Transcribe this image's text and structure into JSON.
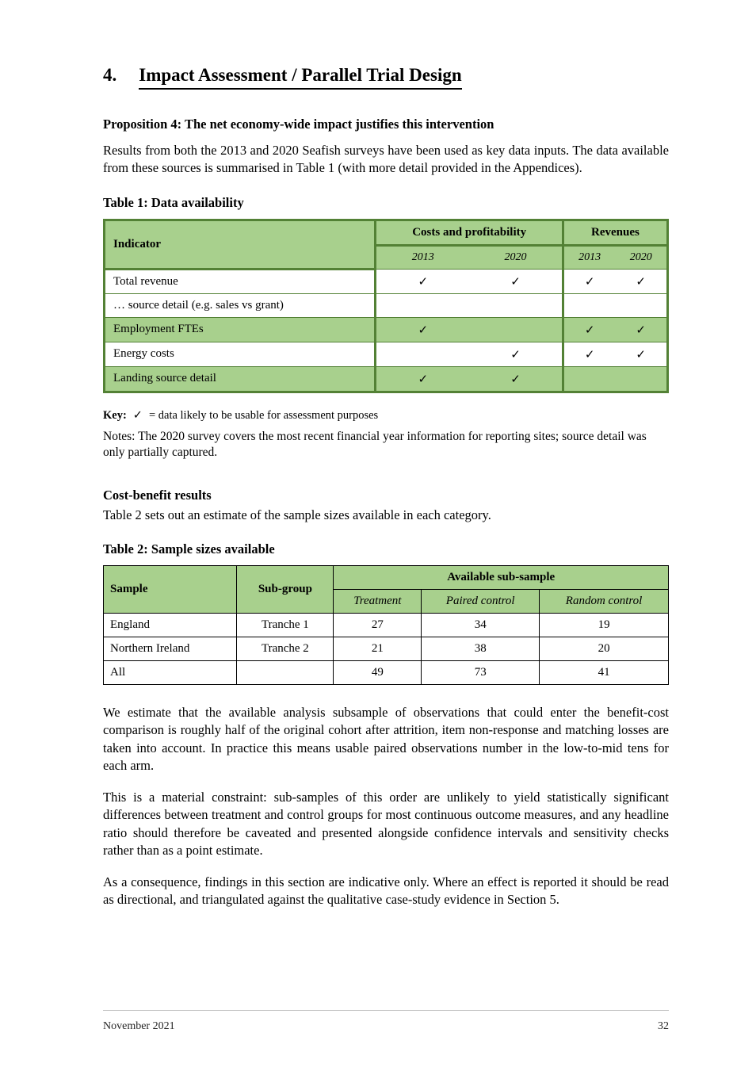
{
  "heading": {
    "num": "4.",
    "text": "Impact Assessment / Parallel Trial Design"
  },
  "intro": {
    "sub": "Proposition 4: The net economy-wide impact justifies this intervention",
    "body": "Results from both the 2013 and 2020 Seafish surveys have been used as key data inputs. The data available from these sources is summarised in Table 1 (with more detail provided in the Appendices)."
  },
  "table1": {
    "caption": "Table 1: Data availability",
    "headers": {
      "lead": "Indicator",
      "span1": "Costs and profitability",
      "span2": "Revenues",
      "sub": [
        "2013",
        "2020",
        "2013",
        "2020"
      ]
    },
    "rows": [
      {
        "label": "Total revenue",
        "cells": [
          "✓",
          "✓",
          "✓",
          "✓"
        ]
      },
      {
        "label": "… source detail (e.g. sales vs grant)",
        "cells": [
          "",
          "",
          "",
          ""
        ]
      },
      {
        "label": "Employment FTEs",
        "cells": [
          "✓",
          "",
          "✓",
          "✓"
        ]
      },
      {
        "label": "Energy costs",
        "cells": [
          "",
          "✓",
          "✓",
          "✓"
        ]
      },
      {
        "label": "Landing source detail",
        "cells": [
          "✓",
          "✓",
          "",
          ""
        ]
      }
    ],
    "footnote": {
      "key": "Key:",
      "mark": "✓",
      "text": "= data likely to be usable for assessment purposes"
    },
    "note": "Notes: The 2020 survey covers the most recent financial year information for reporting sites; source detail was only partially captured."
  },
  "section2": {
    "sub": "Cost-benefit results",
    "body": "Table 2 sets out an estimate of the sample sizes available in each category.",
    "caption": "Table 2: Sample sizes available",
    "headers": {
      "lead": "Sample",
      "sub_lead": "Sub-group",
      "span": "Available sub-sample",
      "sub": [
        "Treatment",
        "Paired control",
        "Random control"
      ]
    },
    "rows": [
      {
        "label": "England",
        "sub": "Tranche 1",
        "cells": [
          "27",
          "34",
          "19"
        ]
      },
      {
        "label": "Northern Ireland",
        "sub": "Tranche 2",
        "cells": [
          "21",
          "38",
          "20"
        ]
      },
      {
        "label": "All",
        "sub": "",
        "cells": [
          "49",
          "73",
          "41"
        ]
      }
    ]
  },
  "paragraphs": [
    "We estimate that the available analysis subsample of observations that could enter the benefit-cost comparison is roughly half of the original cohort after attrition, item non-response and matching losses are taken into account. In practice this means usable paired observations number in the low-to-mid tens for each arm.",
    "This is a material constraint: sub-samples of this order are unlikely to yield statistically significant differences between treatment and control groups for most continuous outcome measures, and any headline ratio should therefore be caveated and presented alongside confidence intervals and sensitivity checks rather than as a point estimate.",
    "As a consequence, findings in this section are indicative only. Where an effect is reported it should be read as directional, and triangulated against the qualitative case-study evidence in Section 5."
  ],
  "footer": {
    "left": "November 2021",
    "right": "32"
  }
}
